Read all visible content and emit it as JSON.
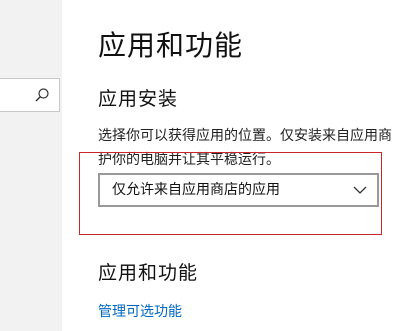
{
  "page": {
    "title": "应用和功能"
  },
  "install_section": {
    "heading": "应用安装",
    "description_line1": "选择你可以获得应用的位置。仅安装来自应用商",
    "description_line2": "护你的电脑并让其平稳运行。",
    "dropdown_value": "仅允许来自应用商店的应用"
  },
  "apps_section": {
    "heading": "应用和功能",
    "link_label": "管理可选功能"
  },
  "colors": {
    "accent_link": "#0067c0",
    "highlight_frame": "#c8282a"
  }
}
